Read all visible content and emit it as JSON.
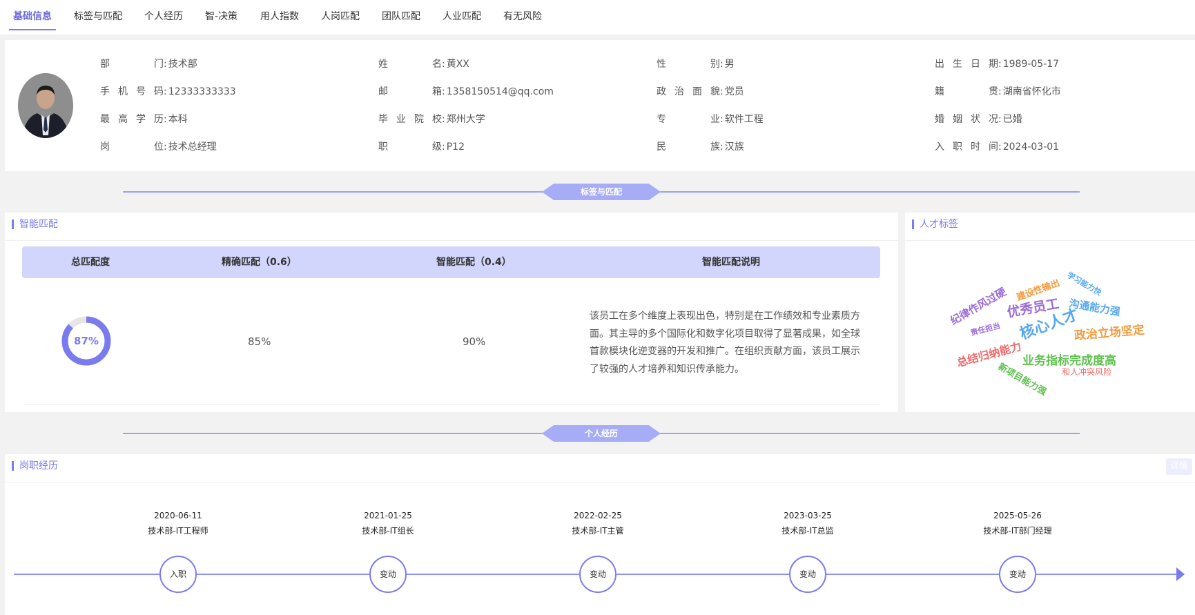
{
  "tabs": [
    "基础信息",
    "标签与匹配",
    "个人经历",
    "智-决策",
    "用人指数",
    "人岗匹配",
    "团队匹配",
    "人业匹配",
    "有无风险"
  ],
  "info": {
    "col1": [
      {
        "label": "部门",
        "value": "技术部"
      },
      {
        "label": "手机号码",
        "value": "12333333333"
      },
      {
        "label": "最高学历",
        "value": "本科"
      },
      {
        "label": "岗位",
        "value": "技术总经理"
      }
    ],
    "col2": [
      {
        "label": "姓名",
        "value": "黄XX"
      },
      {
        "label": "邮箱",
        "value": "1358150514@qq.com"
      },
      {
        "label": "毕业院校",
        "value": "郑州大学"
      },
      {
        "label": "职级",
        "value": "P12"
      }
    ],
    "col3": [
      {
        "label": "性别",
        "value": "男"
      },
      {
        "label": "政治面貌",
        "value": "党员"
      },
      {
        "label": "专业",
        "value": "软件工程"
      },
      {
        "label": "民族",
        "value": "汉族"
      }
    ],
    "col4": [
      {
        "label": "出生日期",
        "value": "1989-05-17"
      },
      {
        "label": "籍贯",
        "value": "湖南省怀化市"
      },
      {
        "label": "婚姻状况",
        "value": "已婚"
      },
      {
        "label": "入职时间",
        "value": "2024-03-01"
      }
    ]
  },
  "sections": {
    "tags_match": "标签与匹配",
    "personal": "个人经历"
  },
  "match": {
    "title": "智能匹配",
    "headers": [
      "总匹配度",
      "精确匹配（0.6）",
      "智能匹配（0.4）",
      "智能匹配说明"
    ],
    "total": "87%",
    "total_fraction": 0.87,
    "exact": "85%",
    "smart": "90%",
    "description": "该员工在多个维度上表现出色，特别是在工作绩效和专业素质方面。其主导的多个国际化和数字化项目取得了显著成果，如全球首款模块化逆变器的开发和推广。在组织贡献方面，该员工展示了较强的人才培养和知识传承能力。"
  },
  "talent": {
    "title": "人才标签",
    "tags": [
      {
        "text": "学习能力快",
        "color": "#56a8f0"
      },
      {
        "text": "建设性输出",
        "color": "#f59a3c"
      },
      {
        "text": "纪律作风过硬",
        "color": "#9b6bd9"
      },
      {
        "text": "优秀员工",
        "color": "#9b6bd9"
      },
      {
        "text": "沟通能力强",
        "color": "#56a8f0"
      },
      {
        "text": "责任担当",
        "color": "#9b6bd9"
      },
      {
        "text": "核心人才",
        "color": "#56a8f0"
      },
      {
        "text": "政治立场坚定",
        "color": "#f59a3c"
      },
      {
        "text": "总结归纳能力",
        "color": "#f26a6a"
      },
      {
        "text": "业务指标完成度高",
        "color": "#5fc24f"
      },
      {
        "text": "新项目能力强",
        "color": "#5fc24f"
      },
      {
        "text": "和人冲突风险",
        "color": "#f26a6a"
      }
    ]
  },
  "career": {
    "title": "岗职经历",
    "detail_label": "详情",
    "events": [
      {
        "date": "2020-06-11",
        "title": "技术部-IT工程师",
        "node": "入职"
      },
      {
        "date": "2021-01-25",
        "title": "技术部-IT组长",
        "node": "变动"
      },
      {
        "date": "2022-02-25",
        "title": "技术部-IT主管",
        "node": "变动"
      },
      {
        "date": "2023-03-25",
        "title": "技术部-IT总监",
        "node": "变动"
      },
      {
        "date": "2025-05-26",
        "title": "技术部-IT部门经理",
        "node": "变动"
      }
    ]
  },
  "colors": {
    "accent": "#7b7bf0",
    "header_bg": "#d3d6fc"
  }
}
